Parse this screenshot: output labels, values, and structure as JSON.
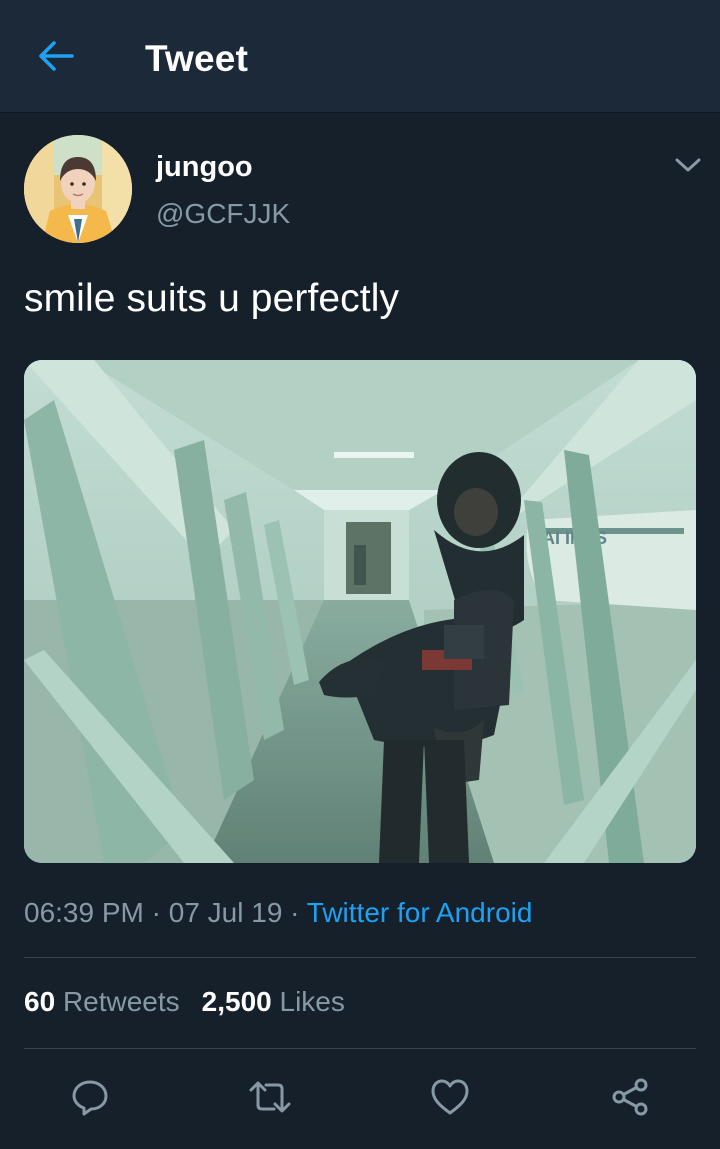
{
  "header": {
    "title": "Tweet",
    "back_icon": "arrow-left-icon"
  },
  "author": {
    "name": "jungoo",
    "handle": "@GCFJJK"
  },
  "tweet": {
    "text": "smile suits u perfectly",
    "time": "06:39 PM",
    "date": "07 Jul 19",
    "separator": "·",
    "source": "Twitter for Android"
  },
  "stats": {
    "retweets_count": "60",
    "retweets_label": "Retweets",
    "likes_count": "2,500",
    "likes_label": "Likes"
  },
  "actions": {
    "reply_icon": "reply-icon",
    "retweet_icon": "retweet-icon",
    "like_icon": "heart-icon",
    "share_icon": "share-icon"
  },
  "colors": {
    "background": "#15202b",
    "header": "#1c2938",
    "accent": "#1da1f2",
    "secondary_text": "#8899a6",
    "divider": "#38444d"
  }
}
